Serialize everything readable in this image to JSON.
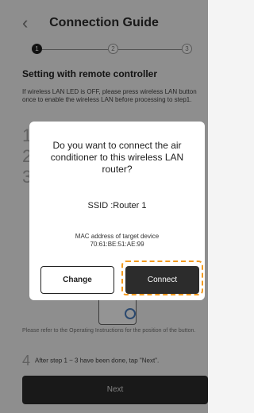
{
  "header": {
    "title": "Connection Guide",
    "back_glyph": "‹"
  },
  "stepper": {
    "steps": [
      "1",
      "2",
      "3"
    ],
    "current": 1
  },
  "heading": "Setting with remote controller",
  "instructions": "If wireless LAN LED is OFF, please press wireless LAN button once to enable the wireless LAN before processing to step1.",
  "background_steps": [
    "1",
    "2",
    "3"
  ],
  "note": "Please refer to the Operating Instructions for the position of the button.",
  "step4": {
    "number": "4",
    "text": "After step 1 ~ 3 have been done, tap \"Next\"."
  },
  "next_label": "Next",
  "dialog": {
    "question": "Do you want to connect the air conditioner to this wireless LAN router?",
    "ssid": "SSID :Router 1",
    "mac_label": "MAC address of target device",
    "mac_value": "70:61:BE:51:AE:99",
    "change_label": "Change",
    "connect_label": "Connect"
  },
  "colors": {
    "highlight": "#f29a1f",
    "primary_button": "#2c2c2c",
    "device_button": "#4a7fbf"
  }
}
